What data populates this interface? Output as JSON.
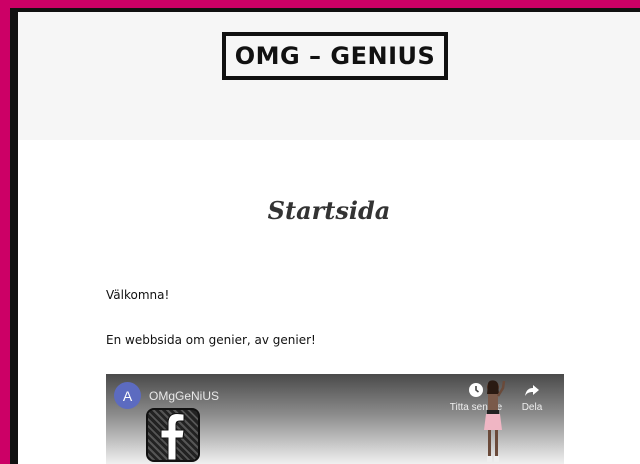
{
  "site": {
    "title": "OMG – GENIUS"
  },
  "page": {
    "title": "Startsida",
    "paragraphs": [
      "Välkomna!",
      "En webbsida om genier, av genier!"
    ]
  },
  "video": {
    "channel_initial": "A",
    "channel_name": "OMgGeNiUS",
    "watch_later_label": "Titta senare",
    "share_label": "Dela"
  },
  "colors": {
    "frame": "#cc0066",
    "header_bg": "#f6f6f6",
    "avatar": "#5c6bc0"
  }
}
